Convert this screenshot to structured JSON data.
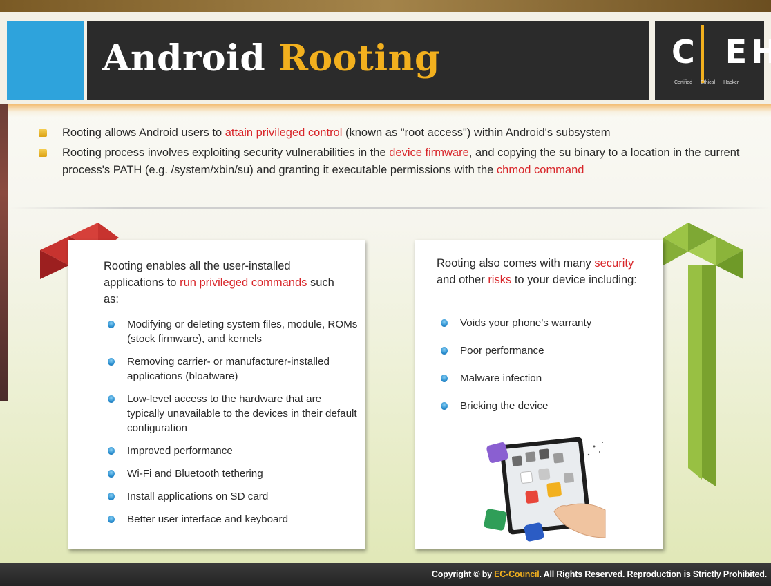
{
  "header": {
    "title_part1": "Android",
    "title_part2": "Rooting",
    "logo_letters": "C|EH",
    "logo_tagline": [
      "Certified",
      "Ethical",
      "Hacker"
    ]
  },
  "intro": {
    "items": [
      {
        "before": "Rooting allows Android users to ",
        "highlight": "attain privileged control",
        "after": " (known as \"root access\") within Android's subsystem"
      },
      {
        "before": "Rooting process involves exploiting  security vulnerabilities  in the ",
        "highlight": "device firmware",
        "middle": ", and copying the su binary to a location in the current process's PATH (e.g. /system/xbin/su) and granting it executable  permissions with the ",
        "highlight2": "chmod command"
      }
    ]
  },
  "left_card": {
    "intro_before": "Rooting enables all the user-installed applications  to ",
    "intro_highlight": "run privileged commands",
    "intro_after": "  such as:",
    "items": [
      "Modifying or deleting system files, module, ROMs (stock firmware), and kernels",
      "Removing carrier- or manufacturer-installed applications (bloatware)",
      "Low-level access to the hardware that are typically unavailable to the devices in their default configuration",
      "Improved performance",
      "Wi-Fi and Bluetooth tethering",
      "Install applications on SD card",
      "Better user interface and keyboard"
    ]
  },
  "right_card": {
    "intro_before": "Rooting also comes with many ",
    "intro_highlight1": "security",
    "intro_middle": " and other ",
    "intro_highlight2": "risks",
    "intro_after": " to your device including:",
    "items": [
      "Voids your phone's warranty",
      "Poor performance",
      "Malware infection",
      "Bricking the device"
    ]
  },
  "footer": {
    "copyright_before": "Copyright © by ",
    "brand": "EC-Council",
    "copyright_after": ". All Rights Reserved. Reproduction is Strictly Prohibited."
  },
  "colors": {
    "highlight": "#d8262a",
    "accent": "#f2b01e",
    "header_dark": "#2b2b2b",
    "blue_block": "#2ea3dc",
    "left_ribbon": "#c0302c",
    "right_ribbon": "#8fb43a"
  },
  "icons": {
    "intro_bullet": "yellow-square-bullet-icon",
    "card_bullet": "blue-dot-bullet-icon",
    "illustration": "tablet-apps-touch-illustration"
  }
}
